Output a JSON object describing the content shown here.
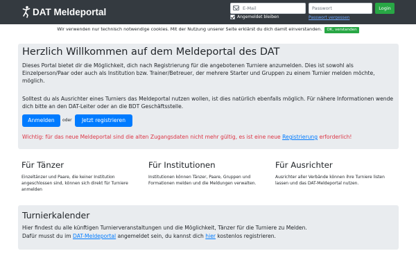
{
  "navbar": {
    "brand": "DAT Meldeportal",
    "email_placeholder": "E-Mail",
    "password_placeholder": "Passwort",
    "remember_label": "Angemeldet bleiben",
    "forgot_label": "Passwort vergessen",
    "login_label": "Login"
  },
  "cookie": {
    "text": "Wir verwenden nur technisch notwendige cookies. Mit der Nutzung unserer Seite erklärst du dich damit einverstanden.",
    "button": "OK, verstanden"
  },
  "welcome": {
    "title": "Herzlich Willkommen auf dem Meldeportal des DAT",
    "p1": "Dieses Portal bietet dir die Möglichkeit, dich nach Registrierung für die angebotenen Turniere anzumelden. Dies ist sowohl als Einzelperson/Paar oder auch als Institution bzw. Trainer/Betreuer, der mehrere Starter und Gruppen zu einem Turnier melden möchte, möglich.",
    "p2": "Solltest du als Ausrichter eines Turniers das Meldeportal nutzen wollen, ist dies natürlich ebenfalls möglich. Für nähere Informationen wende dich bitte an den DAT-Leiter oder an die BDT Geschäftsstelle.",
    "login_button": "Anmelden",
    "or": "oder",
    "register_button": "Jetzt registrieren",
    "warning_before": "Wichtig: für das neue Meldeportal sind die alten Zugangsdaten nicht mehr gültig, es ist eine neue ",
    "warning_link": "Registrierung",
    "warning_after": " erforderlich!"
  },
  "columns": [
    {
      "title": "Für Tänzer",
      "text": "Einzeltänzer und Paare, die keiner Institution angeschlossen sind, können sich direkt für Turniere anmelden"
    },
    {
      "title": "Für Institutionen",
      "text": "Institutionen können Tänzer, Paare, Gruppen und Formationen melden und die Meldungen verwalten."
    },
    {
      "title": "Für Ausrichter",
      "text": "Ausrichter aller Verbände können ihre Turniere listen lassen und das DAT-Meldeportal nutzen."
    }
  ],
  "calendar": {
    "title": "Turnierkalender",
    "line1": "Hier findest du alle künftigen Turnierveranstaltungen und die Möglichkeit, Tänzer für die Turniere zu Melden.",
    "line2_a": "Dafür musst du im ",
    "line2_link1": "DAT-Meldeportal",
    "line2_b": " angemeldet sein, du kannst dich ",
    "line2_link2": "hier",
    "line2_c": " kostenlos registrieren."
  },
  "colors": {
    "navbar": "#343a40",
    "primary": "#007bff",
    "success": "#28a745",
    "danger": "#dc3545",
    "panel": "#e9ecef"
  }
}
